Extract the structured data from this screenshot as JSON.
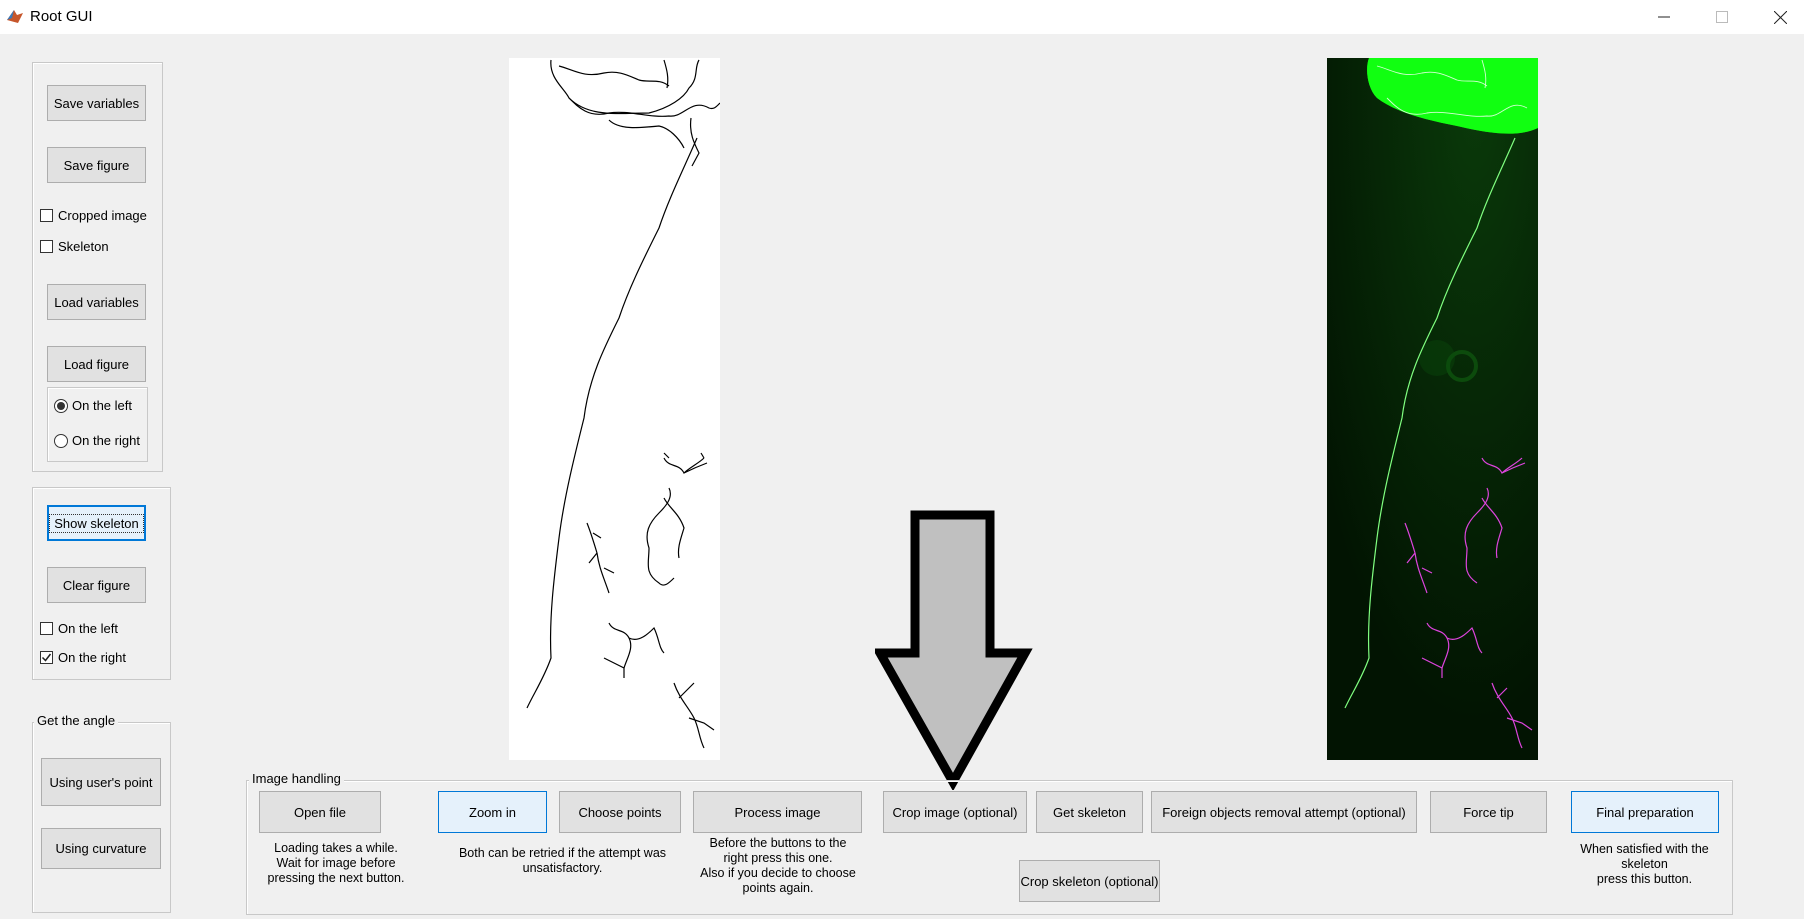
{
  "window": {
    "title": "Root GUI"
  },
  "left_panel": {
    "save_variables": "Save variables",
    "save_figure": "Save figure",
    "cropped_image": {
      "label": "Cropped image",
      "checked": false
    },
    "skeleton": {
      "label": "Skeleton",
      "checked": false
    },
    "load_variables": "Load variables",
    "load_figure": "Load figure",
    "radio_left": {
      "label": "On the left",
      "selected": true
    },
    "radio_right": {
      "label": "On the right",
      "selected": false
    }
  },
  "skeleton_panel": {
    "show_skeleton": "Show skeleton",
    "clear_figure": "Clear figure",
    "check_left": {
      "label": "On the left",
      "checked": false
    },
    "check_right": {
      "label": "On the right",
      "checked": true
    }
  },
  "angle_panel": {
    "title": "Get the angle",
    "using_users_point": "Using user's point",
    "using_curvature": "Using curvature"
  },
  "image_handling": {
    "title": "Image handling",
    "open_file": "Open file",
    "zoom_in": "Zoom in",
    "choose_points": "Choose points",
    "process_image": "Process image",
    "crop_image": "Crop image (optional)",
    "get_skeleton": "Get skeleton",
    "foreign_objects": "Foreign objects removal attempt (optional)",
    "force_tip": "Force tip",
    "final_preparation": "Final preparation",
    "crop_skeleton": "Crop skeleton (optional)",
    "note_open": "Loading takes a while.\nWait for  image before\npressing the next button.",
    "note_retry": "Both can be retried if the attempt was\nunsatisfactory.",
    "note_process": "Before the buttons to the\nright press this one.\nAlso if you decide to choose\npoints again.",
    "note_final": "When satisfied with the\nskeleton\npress this button."
  },
  "colors": {
    "background": "#f0f0f0",
    "skeleton_overlay": "#e040e0",
    "fluorescence": "#00ff00",
    "arrow_fill": "#c0c0c0",
    "focus_border": "#0078d7"
  }
}
